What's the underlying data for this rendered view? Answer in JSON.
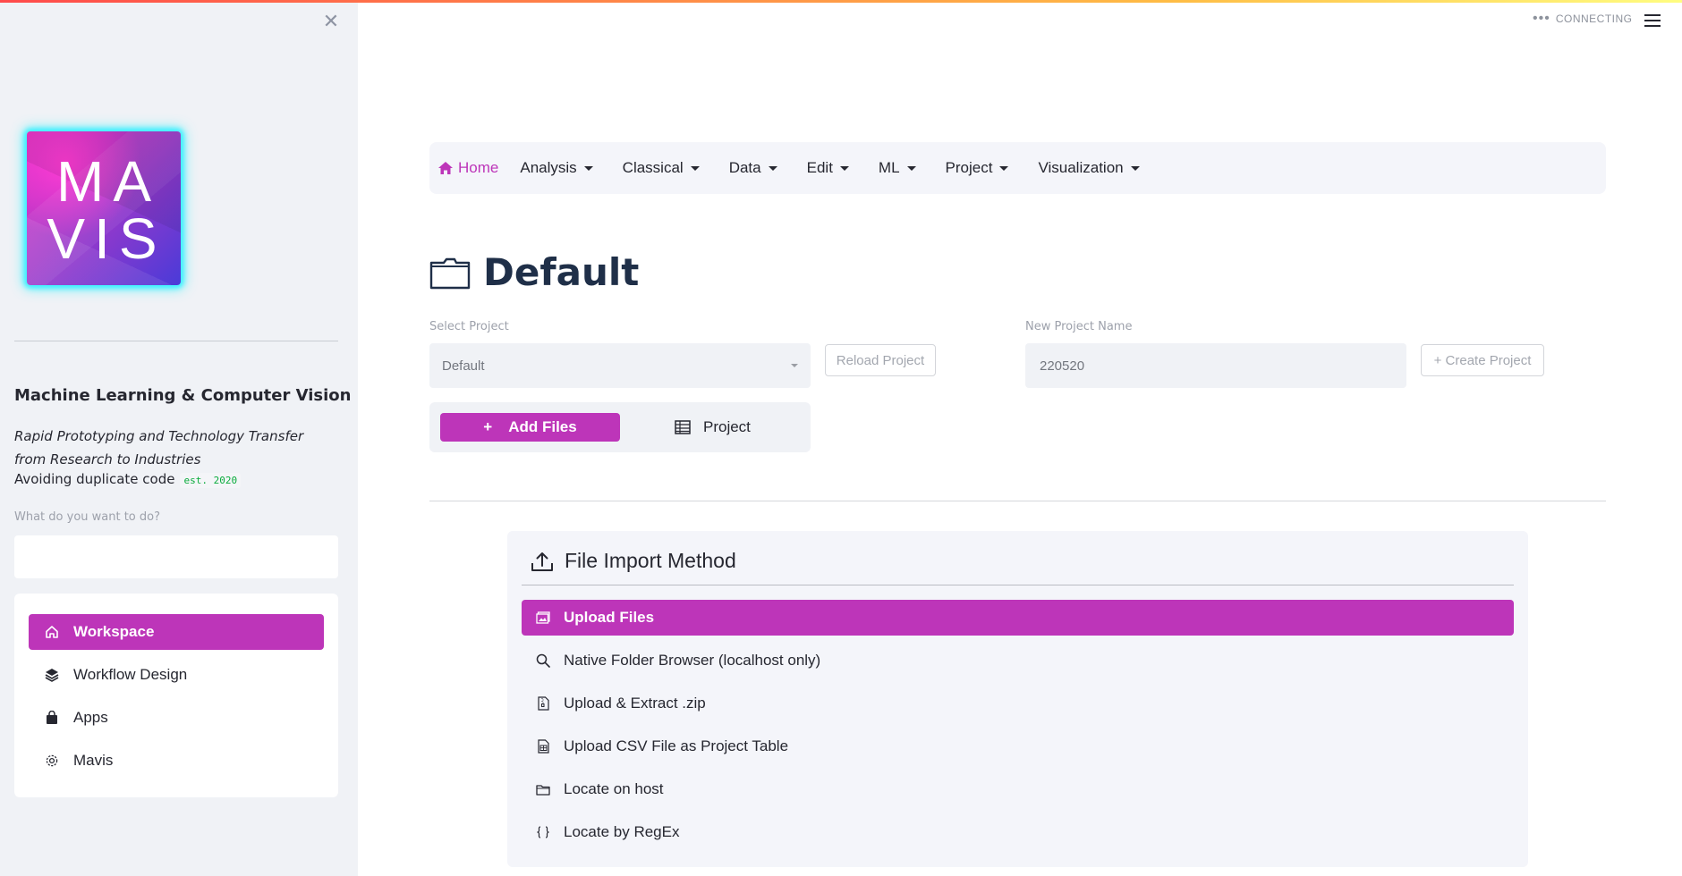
{
  "header": {
    "status": "CONNECTING"
  },
  "sidebar": {
    "logo_line1": "MA",
    "logo_line2": "VIS",
    "title": "Machine Learning & Computer Vision",
    "description": "Rapid Prototyping and Technology Transfer from Research to Industries",
    "tagline": "Avoiding duplicate code",
    "est_badge": "est. 2020",
    "search_label": "What do you want to do?",
    "search_value": "",
    "menu": [
      {
        "label": "Workspace",
        "icon": "home-icon",
        "active": true
      },
      {
        "label": "Workflow Design",
        "icon": "layers-icon",
        "active": false
      },
      {
        "label": "Apps",
        "icon": "bag-icon",
        "active": false
      },
      {
        "label": "Mavis",
        "icon": "gear-icon",
        "active": false
      }
    ]
  },
  "navbar": {
    "home": "Home",
    "items": [
      "Analysis",
      "Classical",
      "Data",
      "Edit",
      "ML",
      "Project",
      "Visualization"
    ]
  },
  "page": {
    "title": "Default",
    "select_project_label": "Select Project",
    "select_project_value": "Default",
    "reload_button": "Reload Project",
    "new_project_label": "New Project Name",
    "new_project_value": "220520",
    "create_button": "+ Create Project",
    "tab_add_files": "Add Files",
    "tab_project": "Project"
  },
  "import_panel": {
    "title": "File Import Method",
    "options": [
      {
        "label": "Upload Files",
        "icon": "image-icon",
        "active": true
      },
      {
        "label": "Native Folder Browser (localhost only)",
        "icon": "search-icon",
        "active": false
      },
      {
        "label": "Upload & Extract .zip",
        "icon": "zip-file-icon",
        "active": false
      },
      {
        "label": "Upload CSV File as Project Table",
        "icon": "csv-file-icon",
        "active": false
      },
      {
        "label": "Locate on host",
        "icon": "folder-icon",
        "active": false
      },
      {
        "label": "Locate by RegEx",
        "icon": "braces-icon",
        "active": false
      }
    ]
  },
  "colors": {
    "accent": "#bd35b9",
    "title": "#1f2f48",
    "sidebar_bg": "#f0f2f6"
  }
}
